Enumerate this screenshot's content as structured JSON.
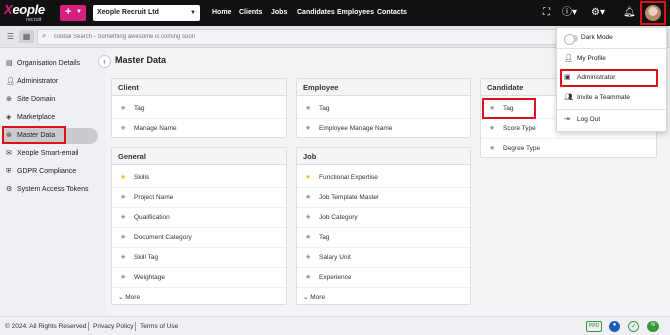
{
  "topbar": {
    "logo_word": "Xeople",
    "logo_sub": "recruit",
    "plus_label": "+",
    "company": "Xeople Recruit Ltd",
    "nav": [
      "Home",
      "Clients",
      "Jobs",
      "Candidates",
      "Employees",
      "Contacts"
    ],
    "icons": [
      "expand-icon",
      "help-icon",
      "gear-icon",
      "bell-icon",
      "avatar"
    ]
  },
  "search": {
    "placeholder": "Global Search - Something awesome is coming soon"
  },
  "sidebar": {
    "items": [
      {
        "label": "Organisation Details",
        "icon": "list-icon"
      },
      {
        "label": "Administrator",
        "icon": "person-icon"
      },
      {
        "label": "Site Domain",
        "icon": "globe-icon"
      },
      {
        "label": "Marketplace",
        "icon": "tag-icon"
      },
      {
        "label": "Master Data",
        "icon": "database-icon",
        "active": true
      },
      {
        "label": "Xeople Smart-email",
        "icon": "mail-icon"
      },
      {
        "label": "GDPR Compliance",
        "icon": "shield-icon"
      },
      {
        "label": "System Access Tokens",
        "icon": "gear-icon"
      }
    ]
  },
  "main": {
    "title": "Master Data",
    "cards": {
      "client": {
        "title": "Client",
        "rows": [
          "Tag",
          "Manage Name"
        ]
      },
      "employee": {
        "title": "Employee",
        "rows": [
          "Tag",
          "Employee Manage Name"
        ]
      },
      "candidate": {
        "title": "Candidate",
        "rows": [
          "Tag",
          "Score Type",
          "Degree Type"
        ]
      },
      "general": {
        "title": "General",
        "rows": [
          "Skills",
          "Project Name",
          "Qualification",
          "Document Category",
          "Skill Tag",
          "Weightage"
        ],
        "more": "More"
      },
      "job": {
        "title": "Job",
        "rows": [
          "Functional Expertise",
          "Job Template Master",
          "Job Category",
          "Tag",
          "Salary Unit",
          "Experience"
        ],
        "more": "More"
      }
    }
  },
  "dropdown": {
    "items": [
      "Dark Mode",
      "My Profile",
      "Administrator",
      "Invite a Teammate",
      "Log Out"
    ]
  },
  "footer": {
    "copyright": "© 2024. All Rights Reserved",
    "privacy": "Privacy Policy",
    "terms": "Terms of Use",
    "badge": "PPD"
  },
  "colors": {
    "brand_pink": "#d6207f",
    "highlight_red": "#e0101a",
    "topbar": "#111111",
    "star_gold": "#f0c419"
  }
}
